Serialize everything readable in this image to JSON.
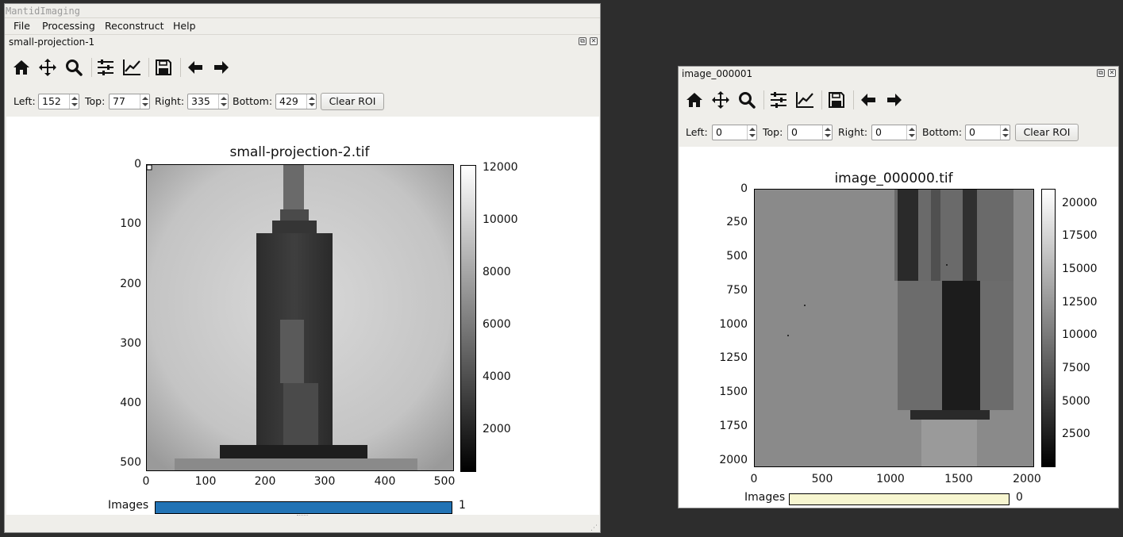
{
  "app": {
    "title": "MantidImaging"
  },
  "menu": [
    "File",
    "Processing",
    "Reconstruct",
    "Help"
  ],
  "main_stack": {
    "dock_title": "small-projection-1",
    "roi": {
      "left_label": "Left:",
      "left": "152",
      "top_label": "Top:",
      "top": "77",
      "right_label": "Right:",
      "right": "335",
      "bottom_label": "Bottom:",
      "bottom": "429",
      "clear_label": "Clear ROI"
    },
    "plot": {
      "title": "small-projection-2.tif",
      "yticks": [
        "0",
        "100",
        "200",
        "300",
        "400",
        "500"
      ],
      "xticks": [
        "0",
        "100",
        "200",
        "300",
        "400",
        "500"
      ],
      "colorbar_ticks": [
        "12000",
        "10000",
        "8000",
        "6000",
        "4000",
        "2000"
      ]
    },
    "slider": {
      "label": "Images",
      "value": "1",
      "fill_fraction": 1.0,
      "color": "#2273b5"
    }
  },
  "second_stack": {
    "dock_title": "image_000001",
    "roi": {
      "left_label": "Left:",
      "left": "0",
      "top_label": "Top:",
      "top": "0",
      "right_label": "Right:",
      "right": "0",
      "bottom_label": "Bottom:",
      "bottom": "0",
      "clear_label": "Clear ROI"
    },
    "plot": {
      "title": "image_000000.tif",
      "yticks": [
        "0",
        "250",
        "500",
        "750",
        "1000",
        "1250",
        "1500",
        "1750",
        "2000"
      ],
      "xticks": [
        "0",
        "500",
        "1000",
        "1500",
        "2000"
      ],
      "colorbar_ticks": [
        "20000",
        "17500",
        "15000",
        "12500",
        "10000",
        "7500",
        "5000",
        "2500"
      ]
    },
    "slider": {
      "label": "Images",
      "value": "0",
      "fill_fraction": 1.0,
      "color": "#f7f6d0"
    }
  },
  "toolbar_icons": [
    "home-icon",
    "pan-icon",
    "zoom-icon",
    "configure-subplots-icon",
    "edit-axis-icon",
    "save-icon",
    "back-icon",
    "forward-icon"
  ]
}
